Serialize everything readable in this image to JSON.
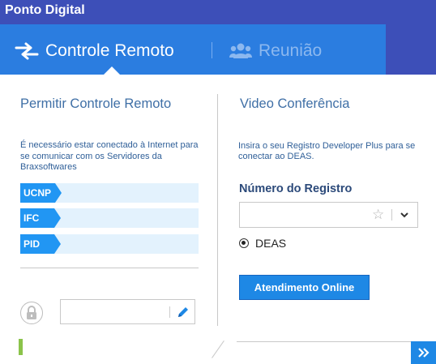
{
  "window": {
    "title": "Ponto Digital"
  },
  "tabs": {
    "active": {
      "label": "Controle Remoto",
      "icon": "arrows-exchange-icon"
    },
    "inactive": {
      "label": "Reunião",
      "icon": "users-icon"
    }
  },
  "left": {
    "title": "Permitir Controle Remoto",
    "description": "É necessário estar conectado à Internet para se comunicar com os Servidores da Braxsoftwares",
    "fields": [
      {
        "tag": "UCNP",
        "value": ""
      },
      {
        "tag": "IFC",
        "value": ""
      },
      {
        "tag": "PID",
        "value": ""
      }
    ],
    "password": {
      "value": "",
      "placeholder": ""
    }
  },
  "right": {
    "title": "Video Conferência",
    "description": "Insira o seu Registro Developer Plus para se conectar ao DEAS.",
    "registro_label": "Número do Registro",
    "registro_value": "",
    "radio_label": "DEAS",
    "button_label": "Atendimento Online"
  },
  "colors": {
    "titlebar": "#3d4fb8",
    "tabbar": "#2b7de0",
    "accent": "#2196f3",
    "field_bg": "#e3f2fd",
    "status_green": "#8bc34a"
  }
}
